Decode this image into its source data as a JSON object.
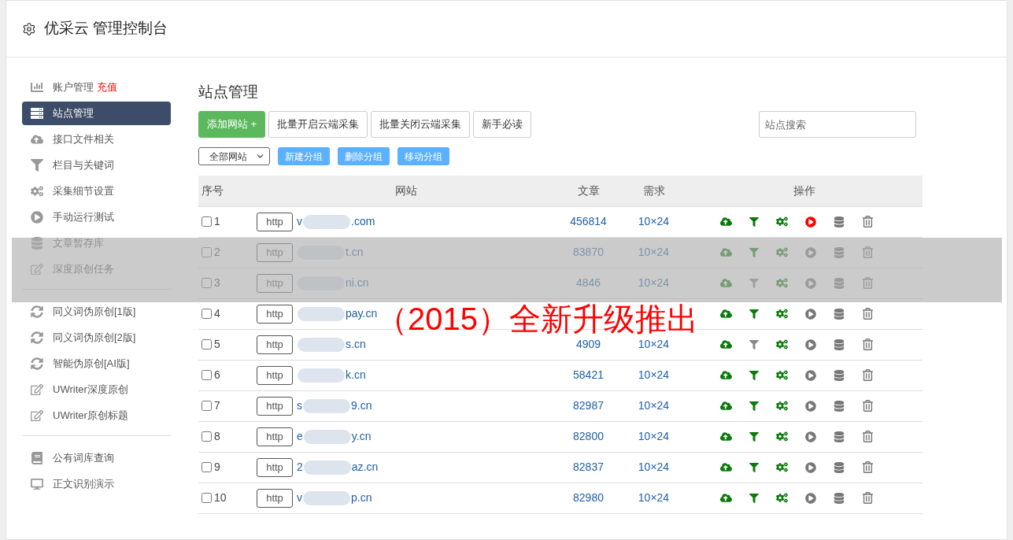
{
  "header": {
    "title": "优采云 管理控制台"
  },
  "sidebar": {
    "groups": [
      {
        "items": [
          {
            "kind": "chart",
            "label": "账户管理",
            "badge": "充值",
            "selected": false
          },
          {
            "kind": "server",
            "label": "站点管理",
            "selected": true
          },
          {
            "kind": "cloud",
            "label": "接口文件相关",
            "selected": false
          },
          {
            "kind": "filter",
            "label": "栏目与关键词",
            "selected": false
          },
          {
            "kind": "cogs",
            "label": "采集细节设置",
            "selected": false
          },
          {
            "kind": "play",
            "label": "手动运行测试",
            "selected": false
          },
          {
            "kind": "database",
            "label": "文章暂存库",
            "selected": false
          },
          {
            "kind": "edit",
            "label": "深度原创任务",
            "selected": false
          }
        ]
      },
      {
        "items": [
          {
            "kind": "sync",
            "label": "同义词伪原创[1版]",
            "selected": false
          },
          {
            "kind": "sync",
            "label": "同义词伪原创[2版]",
            "selected": false
          },
          {
            "kind": "sync",
            "label": "智能伪原创[AI版]",
            "selected": false
          },
          {
            "kind": "edit",
            "label": "UWriter深度原创",
            "selected": false
          },
          {
            "kind": "edit",
            "label": "UWriter原创标题",
            "selected": false
          }
        ]
      },
      {
        "items": [
          {
            "kind": "book",
            "label": "公有词库查询",
            "selected": false
          },
          {
            "kind": "desktop",
            "label": "正文识别演示",
            "selected": false
          }
        ]
      }
    ]
  },
  "main": {
    "title": "站点管理",
    "toolbar": [
      {
        "kind": "primary",
        "label": "添加网站 +"
      },
      {
        "kind": "default",
        "label": "批量开启云端采集"
      },
      {
        "kind": "default",
        "label": "批量关闭云端采集"
      },
      {
        "kind": "default",
        "label": "新手必读"
      }
    ],
    "search": {
      "placeholder": "站点搜索"
    },
    "group_select": {
      "value": "全部网站"
    },
    "group_buttons": [
      "新建分组",
      "删除分组",
      "移动分组"
    ],
    "table": {
      "columns": [
        "序号",
        "网站",
        "文章",
        "需求",
        "操作"
      ],
      "rows": [
        {
          "index": "1",
          "checked": false,
          "scheme": "http",
          "prefix": "v",
          "suffix": ".com",
          "articles": "456814",
          "demand": "10×24",
          "filter_on": true,
          "running": true
        },
        {
          "index": "2",
          "checked": false,
          "scheme": "http",
          "suffix": "t.cn",
          "articles": "83870",
          "demand": "10×24",
          "filter_on": true,
          "running": false
        },
        {
          "index": "3",
          "checked": false,
          "scheme": "http",
          "suffix": "ni.cn",
          "articles": "4846",
          "demand": "10×24",
          "filter_on": false,
          "running": false
        },
        {
          "index": "4",
          "checked": false,
          "scheme": "http",
          "suffix": "pay.cn",
          "filter_on": true,
          "running": false
        },
        {
          "index": "5",
          "checked": false,
          "scheme": "http",
          "suffix": "s.cn",
          "articles": "4909",
          "demand": "10×24",
          "filter_on": false,
          "running": false
        },
        {
          "index": "6",
          "checked": false,
          "scheme": "http",
          "suffix": "k.cn",
          "articles": "58421",
          "demand": "10×24",
          "filter_on": true,
          "running": false
        },
        {
          "index": "7",
          "checked": false,
          "scheme": "http",
          "prefix": "s",
          "suffix": "9.cn",
          "articles": "82987",
          "demand": "10×24",
          "filter_on": true,
          "running": false
        },
        {
          "index": "8",
          "checked": false,
          "scheme": "http",
          "prefix": "e",
          "suffix": "y.cn",
          "articles": "82800",
          "demand": "10×24",
          "filter_on": true,
          "running": false
        },
        {
          "index": "9",
          "checked": false,
          "scheme": "http",
          "prefix": "2",
          "suffix": "az.cn",
          "articles": "82837",
          "demand": "10×24",
          "filter_on": true,
          "running": false
        },
        {
          "index": "10",
          "checked": false,
          "scheme": "http",
          "prefix": "v",
          "suffix": "p.cn",
          "articles": "82980",
          "demand": "10×24",
          "filter_on": true,
          "running": false
        }
      ]
    }
  },
  "banner": {
    "text": "（2015）全新升级推出"
  }
}
